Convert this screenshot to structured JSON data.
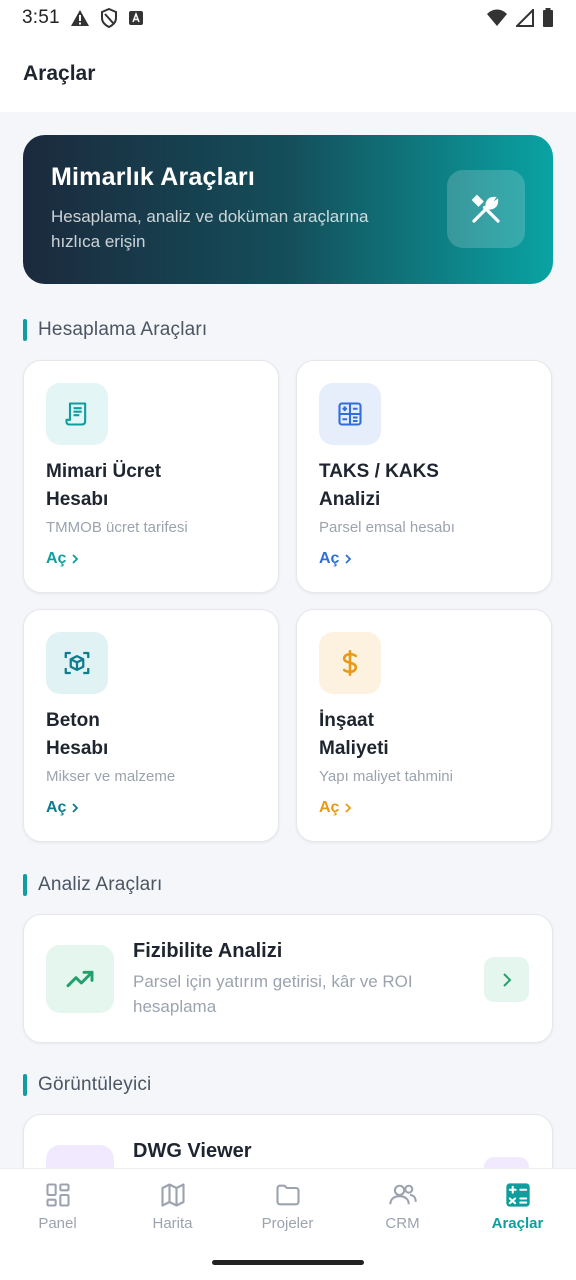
{
  "status_bar": {
    "time": "3:51"
  },
  "app_bar": {
    "title": "Araçlar"
  },
  "hero": {
    "title": "Mimarlık Araçları",
    "subtitle": "Hesaplama, analiz ve doküman araçlarına hızlıca erişin",
    "icon": "tools-icon"
  },
  "sections": {
    "calc": "Hesaplama Araçları",
    "analysis": "Analiz Araçları",
    "viewer": "Görüntüleyici"
  },
  "tools": [
    {
      "name": "Mimari Ücret\nHesabı",
      "desc": "TMMOB ücret tarifesi",
      "action": "Aç",
      "icon": "receipt-icon",
      "color": "#0f9e9e",
      "bg": "#e3f5f4"
    },
    {
      "name": "TAKS / KAKS\nAnalizi",
      "desc": "Parsel emsal hesabı",
      "action": "Aç",
      "icon": "calculator-icon",
      "color": "#2f6fd8",
      "bg": "#e6eefc"
    },
    {
      "name": "Beton\nHesabı",
      "desc": "Mikser ve malzeme",
      "action": "Aç",
      "icon": "cube-scan-icon",
      "color": "#0e7c8c",
      "bg": "#e1f2f4"
    },
    {
      "name": "İnşaat\nMaliyeti",
      "desc": "Yapı maliyet tahmini",
      "action": "Aç",
      "icon": "dollar-icon",
      "color": "#e89a12",
      "bg": "#fdf1e0"
    }
  ],
  "feasibility": {
    "name": "Fizibilite Analizi",
    "desc": "Parsel için yatırım getirisi, kâr ve ROI hesaplama",
    "icon": "trending-up-icon",
    "color": "#22a06b",
    "bg": "#e4f6ee"
  },
  "dwg": {
    "name": "DWG Viewer",
    "icon": "code-icon",
    "color": "#8b5cf6",
    "bg": "#f1eafe"
  },
  "nav": [
    {
      "label": "Panel",
      "icon": "dashboard-icon"
    },
    {
      "label": "Harita",
      "icon": "map-icon"
    },
    {
      "label": "Projeler",
      "icon": "folder-icon"
    },
    {
      "label": "CRM",
      "icon": "people-icon"
    },
    {
      "label": "Araçlar",
      "icon": "calculator-icon",
      "active": true
    }
  ],
  "colors": {
    "accent": "#0f9e9e",
    "background": "#f4f6fa"
  }
}
